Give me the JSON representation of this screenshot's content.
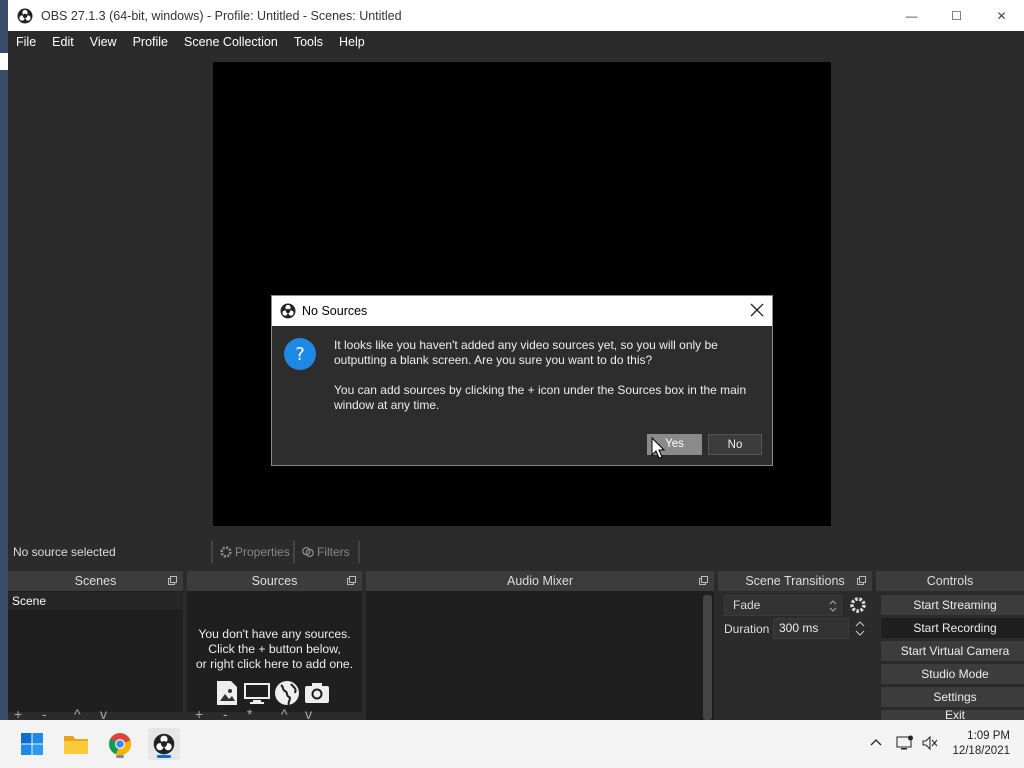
{
  "window": {
    "title": "OBS 27.1.3 (64-bit, windows) - Profile: Untitled - Scenes: Untitled",
    "minimize_glyph": "—",
    "maximize_glyph": "☐",
    "close_glyph": "✕"
  },
  "menu": [
    "File",
    "Edit",
    "View",
    "Profile",
    "Scene Collection",
    "Tools",
    "Help"
  ],
  "source_toolbar": {
    "status": "No source selected",
    "properties_label": "Properties",
    "filters_label": "Filters"
  },
  "docks": {
    "scenes": {
      "title": "Scenes",
      "items": [
        "Scene"
      ]
    },
    "sources": {
      "title": "Sources",
      "empty_lines": [
        "You don't have any sources.",
        "Click the + button below,",
        "or right click here to add one."
      ]
    },
    "mixer": {
      "title": "Audio Mixer"
    },
    "transitions": {
      "title": "Scene Transitions",
      "selected": "Fade",
      "duration_label": "Duration",
      "duration_value": "300 ms"
    },
    "controls": {
      "title": "Controls",
      "buttons": [
        "Start Streaming",
        "Start Recording",
        "Start Virtual Camera",
        "Studio Mode",
        "Settings",
        "Exit"
      ]
    }
  },
  "dialog": {
    "title": "No Sources",
    "message_1_line_1": "It looks like you haven't added any video sources yet, so you will only be",
    "message_1_line_2": "outputting a blank screen. Are you sure you want to do this?",
    "message_2_line_1": "You can add sources by clicking the + icon under the Sources box in the main",
    "message_2_line_2": "window at any time.",
    "yes_label": "Yes",
    "no_label": "No"
  },
  "taskbar": {
    "apps": [
      "start-icon",
      "file-explorer-icon",
      "chrome-icon",
      "obs-icon"
    ],
    "time": "1:09 PM",
    "date": "12/18/2021"
  },
  "colors": {
    "panel_bg": "#2b2b2b",
    "dock_bg": "#1f1f1f",
    "dock_header": "#3c3c3c",
    "accent_blue": "#1e88e5"
  }
}
